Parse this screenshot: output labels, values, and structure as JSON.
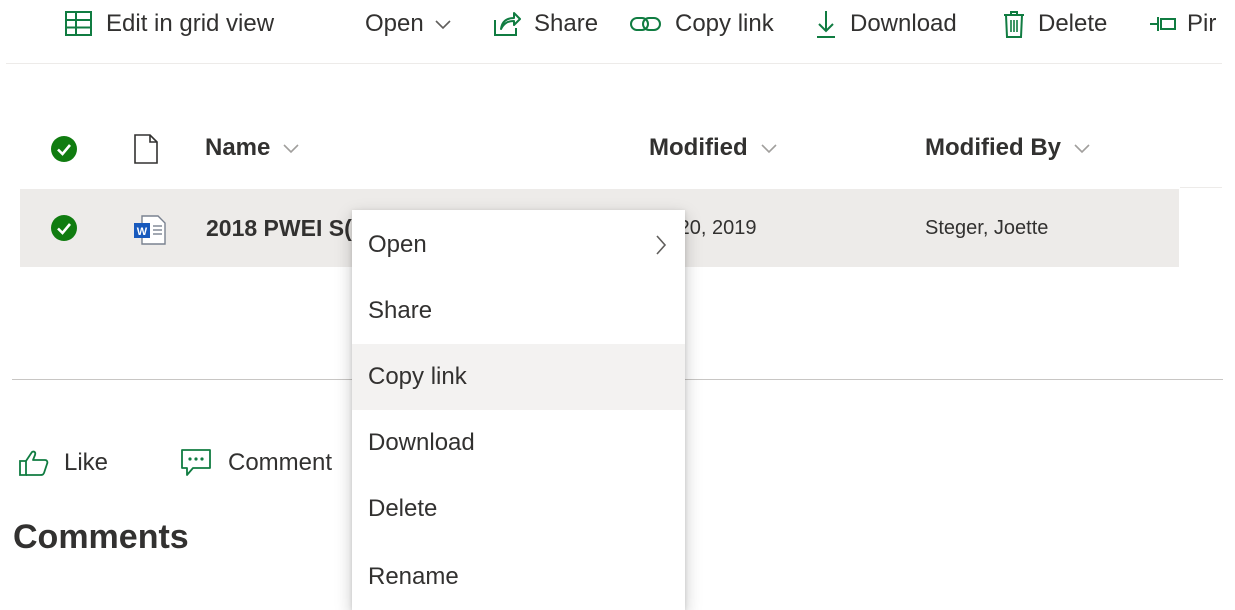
{
  "command_bar": {
    "edit_grid": "Edit in grid view",
    "open": "Open",
    "share": "Share",
    "copy_link": "Copy link",
    "download": "Download",
    "delete": "Delete",
    "pin": "Pir"
  },
  "list": {
    "columns": {
      "name": "Name",
      "modified": "Modified",
      "modified_by": "Modified By"
    },
    "rows": [
      {
        "name": "2018 PWEI S(",
        "modified": "e 20, 2019",
        "modified_by": "Steger, Joette",
        "selected": true,
        "file_type": "word-document"
      }
    ]
  },
  "context_menu": {
    "items": [
      {
        "label": "Open",
        "has_submenu": true
      },
      {
        "label": "Share"
      },
      {
        "label": "Copy link",
        "hovered": true
      },
      {
        "label": "Download"
      },
      {
        "label": "Delete"
      },
      {
        "label": "Rename"
      }
    ]
  },
  "social": {
    "like": "Like",
    "comment": "Comment"
  },
  "comments_section": {
    "title": "Comments"
  },
  "colors": {
    "accent_green": "#107c10",
    "word_blue": "#185abd",
    "icon_green": "#107c41",
    "row_selected": "#edebe9",
    "menu_hover": "#f3f2f1"
  }
}
